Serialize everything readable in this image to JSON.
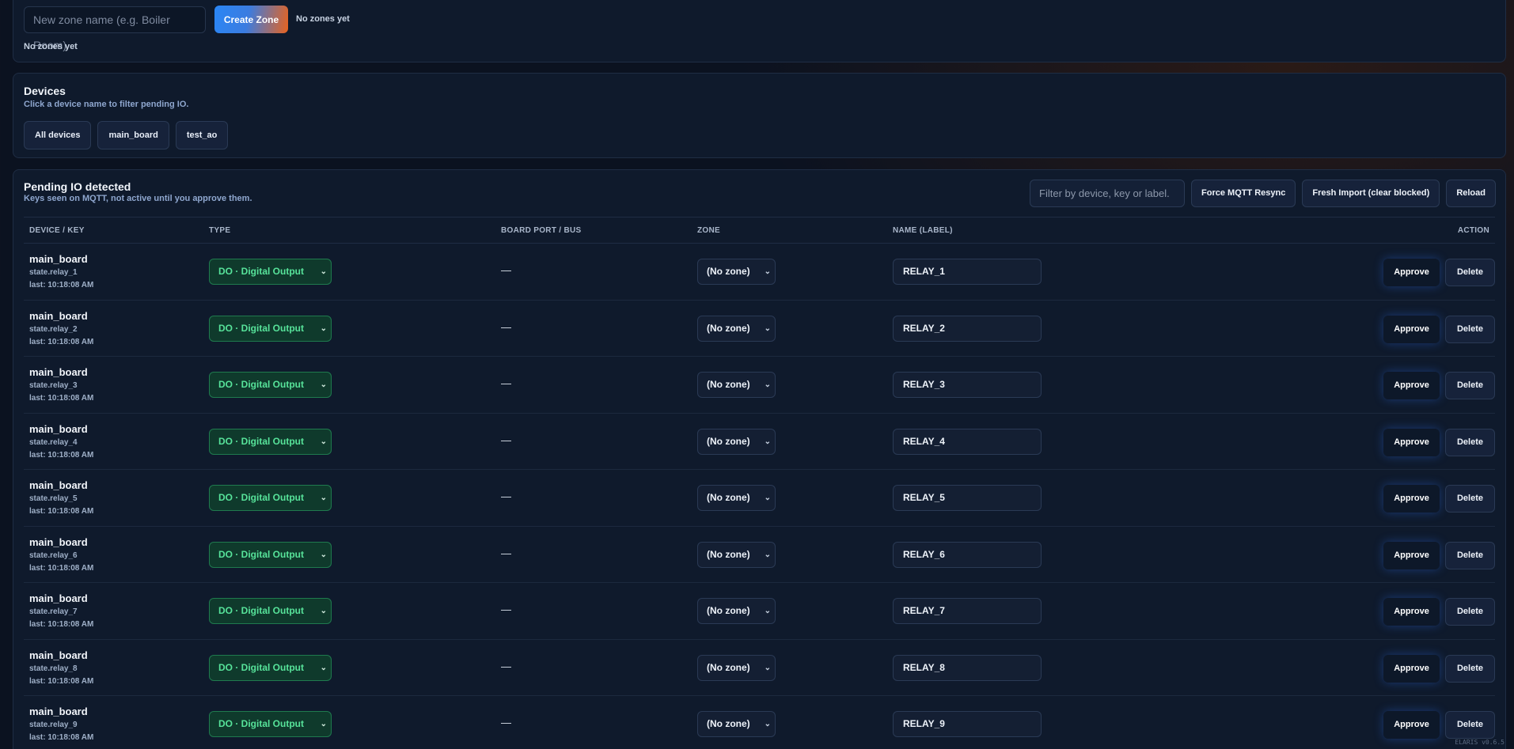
{
  "zones": {
    "input_placeholder": "New zone name (e.g. Boiler Room)",
    "create_label": "Create Zone",
    "empty_inline": "No zones yet",
    "empty_text": "No zones yet"
  },
  "devices": {
    "title": "Devices",
    "subtitle": "Click a device name to filter pending IO.",
    "pills": [
      "All devices",
      "main_board",
      "test_ao"
    ]
  },
  "pending": {
    "title": "Pending IO detected",
    "subtitle": "Keys seen on MQTT, not active until you approve them.",
    "filter_placeholder": "Filter by device, key or label.",
    "buttons": {
      "resync": "Force MQTT Resync",
      "fresh_import": "Fresh Import (clear blocked)",
      "reload": "Reload"
    },
    "columns": {
      "device_key": "DEVICE / KEY",
      "type": "TYPE",
      "port": "BOARD PORT / BUS",
      "zone": "ZONE",
      "name": "NAME (LABEL)",
      "action": "ACTION"
    },
    "rows": [
      {
        "device": "main_board",
        "key": "state.relay_1",
        "last": "last: 10:18:08 AM",
        "type": "DO · Digital Output",
        "port": "—",
        "zone": "(No zone)",
        "label": "RELAY_1",
        "approve": "Approve",
        "delete": "Delete"
      },
      {
        "device": "main_board",
        "key": "state.relay_2",
        "last": "last: 10:18:08 AM",
        "type": "DO · Digital Output",
        "port": "—",
        "zone": "(No zone)",
        "label": "RELAY_2",
        "approve": "Approve",
        "delete": "Delete"
      },
      {
        "device": "main_board",
        "key": "state.relay_3",
        "last": "last: 10:18:08 AM",
        "type": "DO · Digital Output",
        "port": "—",
        "zone": "(No zone)",
        "label": "RELAY_3",
        "approve": "Approve",
        "delete": "Delete"
      },
      {
        "device": "main_board",
        "key": "state.relay_4",
        "last": "last: 10:18:08 AM",
        "type": "DO · Digital Output",
        "port": "—",
        "zone": "(No zone)",
        "label": "RELAY_4",
        "approve": "Approve",
        "delete": "Delete"
      },
      {
        "device": "main_board",
        "key": "state.relay_5",
        "last": "last: 10:18:08 AM",
        "type": "DO · Digital Output",
        "port": "—",
        "zone": "(No zone)",
        "label": "RELAY_5",
        "approve": "Approve",
        "delete": "Delete"
      },
      {
        "device": "main_board",
        "key": "state.relay_6",
        "last": "last: 10:18:08 AM",
        "type": "DO · Digital Output",
        "port": "—",
        "zone": "(No zone)",
        "label": "RELAY_6",
        "approve": "Approve",
        "delete": "Delete"
      },
      {
        "device": "main_board",
        "key": "state.relay_7",
        "last": "last: 10:18:08 AM",
        "type": "DO · Digital Output",
        "port": "—",
        "zone": "(No zone)",
        "label": "RELAY_7",
        "approve": "Approve",
        "delete": "Delete"
      },
      {
        "device": "main_board",
        "key": "state.relay_8",
        "last": "last: 10:18:08 AM",
        "type": "DO · Digital Output",
        "port": "—",
        "zone": "(No zone)",
        "label": "RELAY_8",
        "approve": "Approve",
        "delete": "Delete"
      },
      {
        "device": "main_board",
        "key": "state.relay_9",
        "last": "last: 10:18:08 AM",
        "type": "DO · Digital Output",
        "port": "—",
        "zone": "(No zone)",
        "label": "RELAY_9",
        "approve": "Approve",
        "delete": "Delete"
      }
    ]
  },
  "footer": {
    "version": "ELARIS v0.6.5"
  },
  "icons": {
    "dropdown": "chevron-down-icon"
  }
}
